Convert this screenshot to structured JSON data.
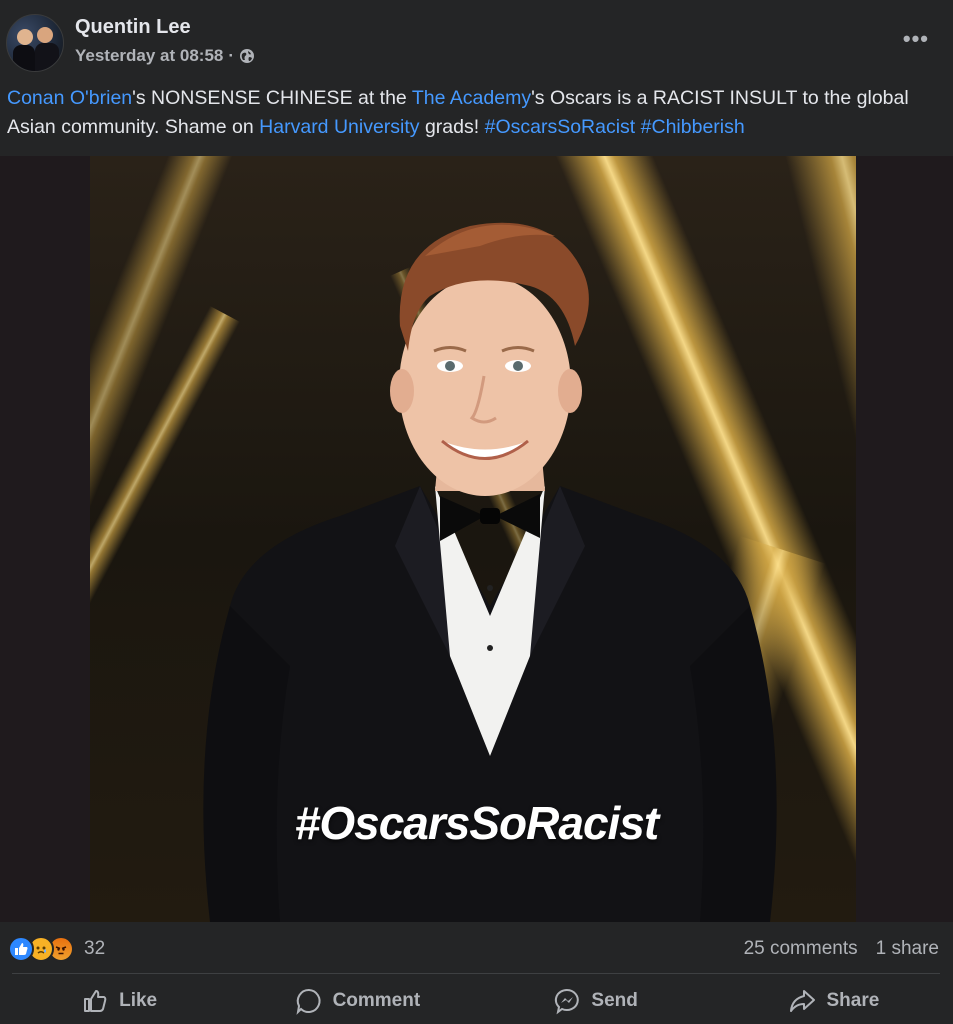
{
  "post": {
    "author": "Quentin Lee",
    "timestamp": "Yesterday at 08:58",
    "separator": "·",
    "privacy_icon": "globe-icon",
    "more_label": "•••",
    "caption": {
      "link1": "Conan O'brien",
      "text1": "'s NONSENSE CHINESE at the ",
      "link2": "The Academy",
      "text2": "'s Oscars is a RACIST INSULT to the global Asian community. Shame on ",
      "link3": "Harvard University",
      "text3": " grads! ",
      "hashtag1": "#OscarsSoRacist",
      "space": " ",
      "hashtag2": "#Chibberish"
    },
    "image_overlay_text": "#OscarsSoRacist"
  },
  "engagement": {
    "reaction_icons": [
      "like-icon",
      "sad-icon",
      "angry-icon"
    ],
    "reaction_count": "32",
    "comments": "25 comments",
    "shares": "1 share"
  },
  "actions": {
    "like": "Like",
    "comment": "Comment",
    "send": "Send",
    "share": "Share"
  },
  "colors": {
    "background": "#242526",
    "link": "#4599ff",
    "text": "#e4e6eb",
    "muted": "#b0b3b8",
    "like_blue": "#2d88ff"
  }
}
